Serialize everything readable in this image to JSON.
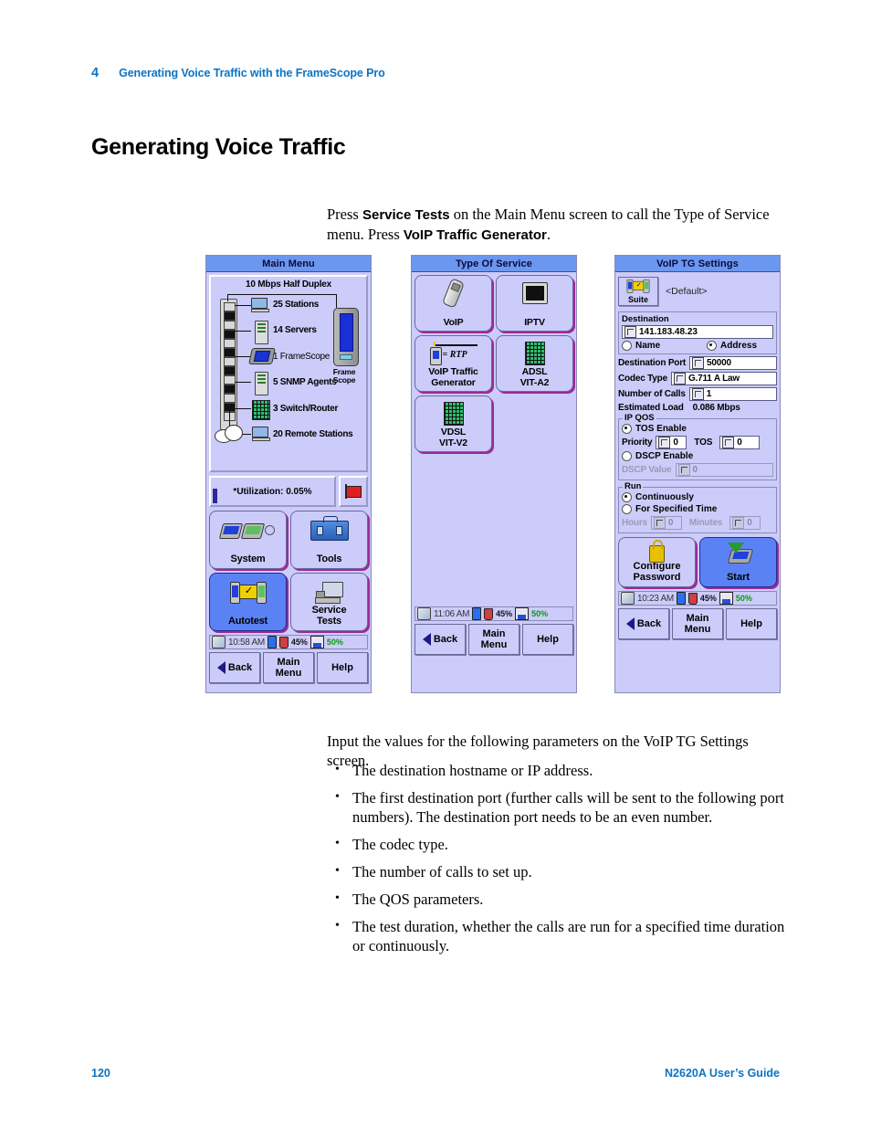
{
  "header": {
    "chapter_number": "4",
    "chapter_title": "Generating Voice Traffic with the FrameScope Pro"
  },
  "page_title": "Generating Voice Traffic",
  "intro_paragraph": {
    "part1": "Press ",
    "bold1": "Service Tests",
    "part2": " on the Main Menu screen to call the Type of Service menu. Press ",
    "bold2": "VoIP Traffic Generator",
    "part3": "."
  },
  "after_paragraph": "Input the values for the following parameters on the VoIP TG Settings screen.",
  "bullets": [
    "The destination hostname or IP address.",
    "The first destination port (further calls will be sent to the following port numbers). The destination port needs to be an even number.",
    "The codec type.",
    "The number of calls to set up.",
    "The QOS parameters.",
    "The test duration, whether the calls are run for a specified time duration or continuously."
  ],
  "footer": {
    "page_number": "120",
    "guide_name": "N2620A User’s Guide"
  },
  "colors": {
    "accent_blue": "#0B74C4",
    "titlebar_blue": "#6C97F0",
    "screen_lavender": "#CCCCFA",
    "selected_blue": "#5A82F5"
  },
  "nav_buttons": {
    "back": "Back",
    "main_menu": "Main\nMenu",
    "main_menu_line1": "Main",
    "main_menu_line2": "Menu",
    "help": "Help"
  },
  "screen_main_menu": {
    "title": "Main Menu",
    "link_rate": "10 Mbps Half Duplex",
    "framescope_caption_line1": "Frame",
    "framescope_caption_line2": "Scope",
    "nodes": [
      {
        "count_label": "25 Stations",
        "icon": "pc-icon"
      },
      {
        "count_label": "14 Servers",
        "icon": "server-icon"
      },
      {
        "count_label": "1 FrameScope",
        "icon": "framescope-icon"
      },
      {
        "count_label": "5 SNMP Agents",
        "icon": "server-icon"
      },
      {
        "count_label": "3 Switch/Router",
        "icon": "switch-icon"
      },
      {
        "count_label": "20 Remote Stations",
        "icon": "pc-icon"
      }
    ],
    "utilization": "*Utilization: 0.05%",
    "tiles": [
      {
        "label": "System",
        "icon": "system-icon",
        "selected": false
      },
      {
        "label": "Tools",
        "icon": "toolbox-icon",
        "selected": false
      },
      {
        "label": "Autotest",
        "icon": "autotest-icon",
        "selected": true
      },
      {
        "label_line1": "Service",
        "label_line2": "Tests",
        "icon": "service-tests-icon",
        "selected": false
      }
    ],
    "status": {
      "time": "10:58 AM",
      "battery_pct": "45%",
      "storage_pct": "50%"
    }
  },
  "screen_type_of_service": {
    "title": "Type Of Service",
    "tiles": [
      {
        "label_line1": "VoIP",
        "label_line2": "",
        "icon": "phone-icon"
      },
      {
        "label_line1": "IPTV",
        "label_line2": "",
        "icon": "tv-icon"
      },
      {
        "label_line1": "VoIP Traffic",
        "label_line2": "Generator",
        "icon": "rtp-icon"
      },
      {
        "label_line1": "ADSL",
        "label_line2": "VIT-A2",
        "icon": "dsl-icon"
      },
      {
        "label_line1": "VDSL",
        "label_line2": "VIT-V2",
        "icon": "dsl-icon"
      }
    ],
    "rtp_icon_text": "= RTP",
    "status": {
      "time": "11:06 AM",
      "battery_pct": "45%",
      "storage_pct": "50%"
    }
  },
  "screen_voip_tg": {
    "title": "VoIP TG Settings",
    "suite_button_label": "Suite",
    "suite_value": "<Default>",
    "destination": {
      "legend": "Destination",
      "address_value": "141.183.48.23",
      "radio_name_label": "Name",
      "radio_name_selected": false,
      "radio_address_label": "Address",
      "radio_address_selected": true
    },
    "fields": [
      {
        "label": "Destination Port",
        "value": "50000",
        "disabled": false
      },
      {
        "label": "Codec Type",
        "value": "G.711 A Law",
        "disabled": false
      },
      {
        "label": "Number of Calls",
        "value": "1",
        "disabled": false
      }
    ],
    "estimated_load": {
      "label": "Estimated Load",
      "value": "0.086 Mbps"
    },
    "ip_qos": {
      "legend": "IP QOS",
      "tos_enable_label": "TOS Enable",
      "tos_enable_selected": true,
      "priority_label": "Priority",
      "priority_value": "0",
      "tos_label": "TOS",
      "tos_value": "0",
      "dscp_enable_label": "DSCP  Enable",
      "dscp_enable_selected": false,
      "dscp_value_label": "DSCP Value",
      "dscp_value": "0"
    },
    "run": {
      "legend": "Run",
      "continuously_label": "Continuously",
      "continuously_selected": true,
      "specified_time_label": "For Specified Time",
      "specified_time_selected": false,
      "hours_label": "Hours",
      "hours_value": "0",
      "minutes_label": "Minutes",
      "minutes_value": "0"
    },
    "actions": [
      {
        "label_line1": "Configure",
        "label_line2": "Password",
        "icon": "lock-icon",
        "selected": false
      },
      {
        "label_line1": "Start",
        "label_line2": "",
        "icon": "start-icon",
        "selected": true
      }
    ],
    "status": {
      "time": "10:23 AM",
      "battery_pct": "45%",
      "storage_pct": "50%"
    }
  }
}
